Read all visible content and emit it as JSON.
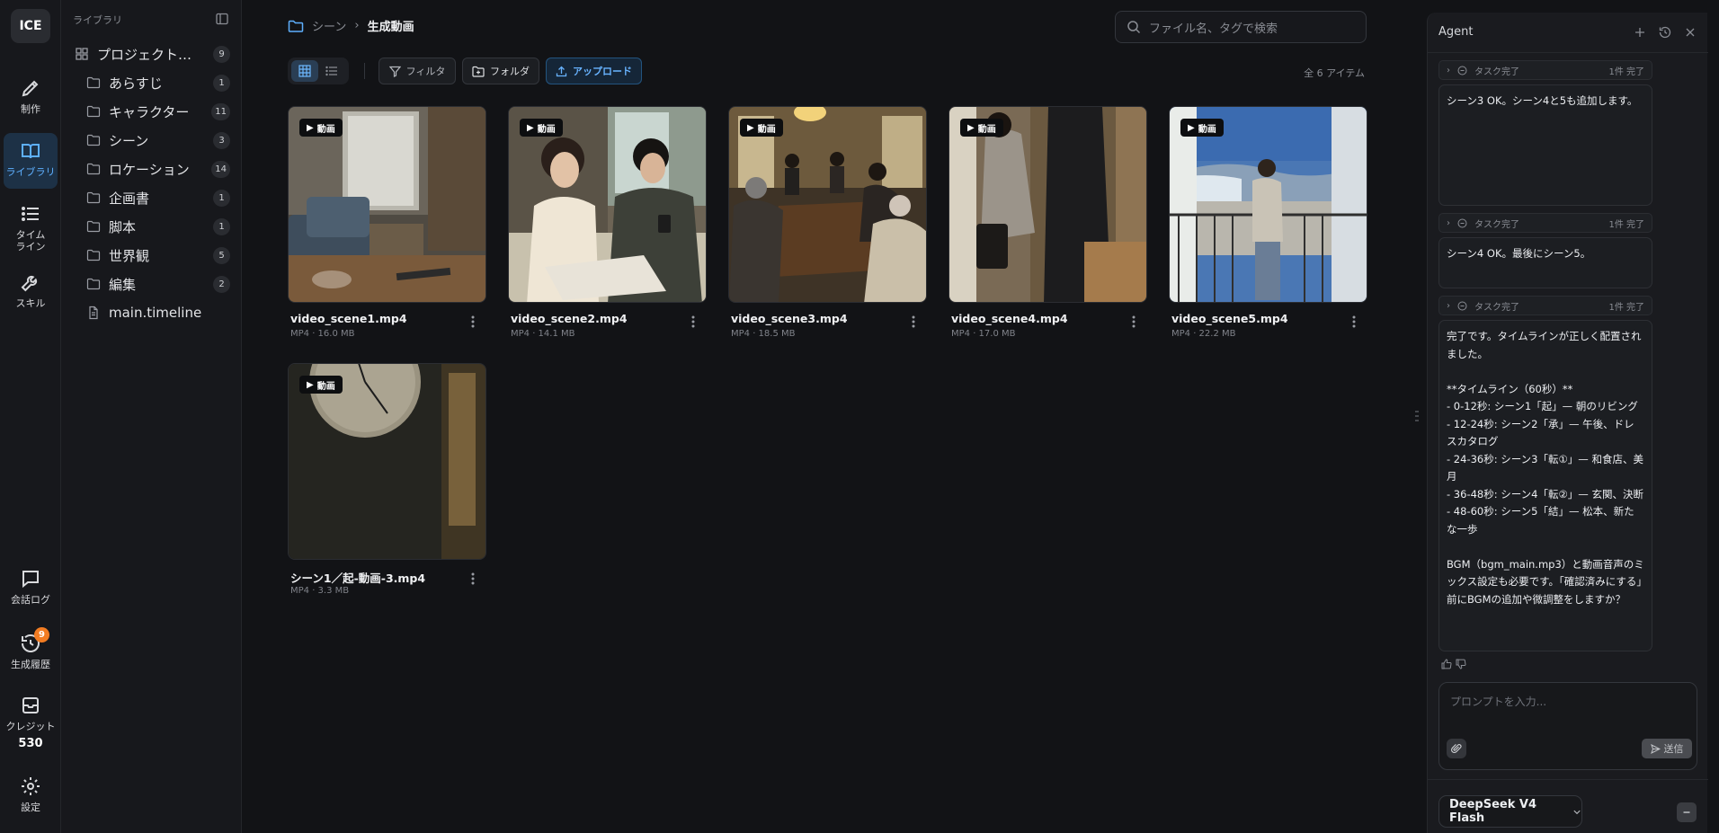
{
  "app": {
    "logo": "ICE"
  },
  "rail": {
    "items": [
      {
        "label": "制作",
        "icon": "pen-icon"
      },
      {
        "label": "ライブラリ",
        "icon": "book-icon",
        "active": true
      },
      {
        "label": "タイム\nライン",
        "icon": "list-icon"
      },
      {
        "label": "スキル",
        "icon": "wrench-icon"
      }
    ],
    "bottom": [
      {
        "label": "会話ログ",
        "icon": "chat-icon"
      },
      {
        "label": "生成履歴",
        "icon": "history-icon",
        "badge": "9"
      },
      {
        "label": "クレジット",
        "icon": "credit-icon",
        "value": "530"
      },
      {
        "label": "設定",
        "icon": "gear-icon"
      }
    ]
  },
  "library": {
    "header": "ライブラリ",
    "items": [
      {
        "label": "プロジェクトア…",
        "count": "9",
        "icon": "grid-icon"
      },
      {
        "label": "あらすじ",
        "count": "1",
        "icon": "folder-icon"
      },
      {
        "label": "キャラクター",
        "count": "11",
        "icon": "folder-icon"
      },
      {
        "label": "シーン",
        "count": "3",
        "icon": "folder-icon"
      },
      {
        "label": "ロケーション",
        "count": "14",
        "icon": "folder-icon"
      },
      {
        "label": "企画書",
        "count": "1",
        "icon": "folder-icon"
      },
      {
        "label": "脚本",
        "count": "1",
        "icon": "folder-icon"
      },
      {
        "label": "世界観",
        "count": "5",
        "icon": "folder-icon"
      },
      {
        "label": "編集",
        "count": "2",
        "icon": "folder-icon"
      },
      {
        "label": "main.timeline",
        "count": "",
        "icon": "file-icon"
      }
    ]
  },
  "main": {
    "breadcrumb": {
      "parent": "シーン",
      "current": "生成動画"
    },
    "search_placeholder": "ファイル名、タグで検索",
    "toolbar": {
      "filter": "フィルタ",
      "folder": "フォルダ",
      "upload": "アップロード"
    },
    "total": "全 6 アイテム",
    "badge_label": "動画",
    "files": [
      {
        "name": "video_scene1.mp4",
        "meta": "MP4 · 16.0 MB",
        "scene": "living"
      },
      {
        "name": "video_scene2.mp4",
        "meta": "MP4 · 14.1 MB",
        "scene": "catalog"
      },
      {
        "name": "video_scene3.mp4",
        "meta": "MP4 · 18.5 MB",
        "scene": "dinner"
      },
      {
        "name": "video_scene4.mp4",
        "meta": "MP4 · 17.0 MB",
        "scene": "entrance"
      },
      {
        "name": "video_scene5.mp4",
        "meta": "MP4 · 22.2 MB",
        "scene": "balcony"
      },
      {
        "name": "シーン1／起-動画-3.mp4",
        "meta": "MP4 · 3.3 MB",
        "scene": "clock"
      }
    ]
  },
  "agent": {
    "title": "Agent",
    "task_label": "タスク完了",
    "task_count": "1件 完了",
    "messages": [
      "シーン3 OK。シーン4と5も追加します。",
      "シーン4 OK。最後にシーン5。",
      "完了です。タイムラインが正しく配置されました。\n\n**タイムライン（60秒）**\n- 0-12秒: シーン1「起」— 朝のリビング\n- 12-24秒: シーン2「承」— 午後、ドレスカタログ\n- 24-36秒: シーン3「転①」— 和食店、美月\n- 36-48秒: シーン4「転②」— 玄関、決断\n- 48-60秒: シーン5「結」— 松本、新たな一歩\n\nBGM（bgm_main.mp3）と動画音声のミックス設定も必要です。「確認済みにする」前にBGMの追加や微調整をしますか？"
    ],
    "prompt_placeholder": "プロンプトを入力...",
    "send_label": "送信",
    "model": "DeepSeek V4 Flash"
  }
}
